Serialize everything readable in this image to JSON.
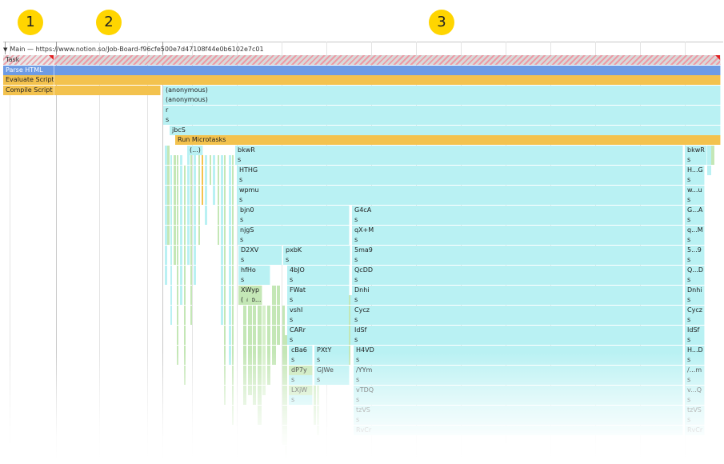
{
  "markers": [
    "1",
    "2",
    "3"
  ],
  "thread_title": "Main — https://www.notion.so/Job-Board-f96cfe500e7d47108f44e0b6102e7c01",
  "colors": {
    "js": "#b9f1f3",
    "js_small": "#c4e7b6",
    "script": "#f3c24e",
    "parse": "#6d9be4",
    "long_task_flag": "#e02020",
    "marker": "#ffd500"
  },
  "left_pane": [
    "Task",
    "Parse HTML",
    "Evaluate Script",
    "Compile Script"
  ],
  "rows": [
    {
      "kind": "task",
      "entries": [
        "Task"
      ]
    },
    {
      "kind": "parse",
      "entries": [
        "Parse HTML"
      ]
    },
    {
      "kind": "script",
      "entries": [
        "Evaluate Script"
      ]
    },
    {
      "kind": "script",
      "entries": [
        "Compile Script",
        "(anonymous)"
      ]
    },
    {
      "kind": "js",
      "entries": [
        "(anonymous)"
      ]
    },
    {
      "kind": "js",
      "entries": [
        "r"
      ]
    },
    {
      "kind": "js",
      "entries": [
        "s"
      ]
    },
    {
      "kind": "js",
      "entries": [
        "jbcS"
      ]
    },
    {
      "kind": "script",
      "entries": [
        "Run Microtasks"
      ]
    },
    {
      "kind": "js",
      "entries": [
        "(...)",
        "bkwR",
        "bkwR"
      ]
    },
    {
      "kind": "js",
      "entries": [
        "s",
        "s"
      ]
    },
    {
      "kind": "js",
      "entries": [
        "HTHG",
        "H...G"
      ]
    },
    {
      "kind": "js",
      "entries": [
        "s",
        "s"
      ]
    },
    {
      "kind": "js",
      "entries": [
        "wpmu",
        "w...u"
      ]
    },
    {
      "kind": "js",
      "entries": [
        "s",
        "s"
      ]
    },
    {
      "kind": "js",
      "entries": [
        "bjn0",
        "G4cA",
        "G...A"
      ]
    },
    {
      "kind": "js",
      "entries": [
        "s",
        "s",
        "s"
      ]
    },
    {
      "kind": "js",
      "entries": [
        "njgS",
        "qX+M",
        "q...M"
      ]
    },
    {
      "kind": "js",
      "entries": [
        "s",
        "s",
        "s"
      ]
    },
    {
      "kind": "js",
      "entries": [
        "D2XV",
        "pxbK",
        "5ma9",
        "5...9"
      ]
    },
    {
      "kind": "js",
      "entries": [
        "s",
        "s",
        "s",
        "s"
      ]
    },
    {
      "kind": "js",
      "entries": [
        "hfHo",
        "4bJO",
        "QcDD",
        "Q...D"
      ]
    },
    {
      "kind": "js",
      "entries": [
        "s",
        "s",
        "s",
        "s"
      ]
    },
    {
      "kind": "js",
      "entries": [
        "XWyp",
        "FWat",
        "Dnhi",
        "Dnhi"
      ]
    },
    {
      "kind": "js",
      "entries": [
        "(ano...us)",
        "s",
        "s",
        "s"
      ]
    },
    {
      "kind": "js",
      "entries": [
        "vshI",
        "Cycz",
        "Cycz"
      ]
    },
    {
      "kind": "js",
      "entries": [
        "s",
        "s",
        "s"
      ]
    },
    {
      "kind": "js",
      "entries": [
        "CARr",
        "IdSf",
        "IdSf"
      ]
    },
    {
      "kind": "js",
      "entries": [
        "s",
        "s",
        "s"
      ]
    },
    {
      "kind": "js",
      "entries": [
        "cBa6",
        "PXtY",
        "H4VD",
        "H...D"
      ]
    },
    {
      "kind": "js",
      "entries": [
        "s",
        "s",
        "s",
        "s"
      ]
    },
    {
      "kind": "js",
      "entries": [
        "dP7y",
        "GJWe",
        "/YYm",
        "/...m"
      ]
    },
    {
      "kind": "js",
      "entries": [
        "s",
        "s",
        "s",
        "s"
      ]
    },
    {
      "kind": "js",
      "entries": [
        "LXjW",
        "vTDQ",
        "v...Q"
      ]
    },
    {
      "kind": "js",
      "entries": [
        "s",
        "s",
        "s"
      ]
    },
    {
      "kind": "js",
      "entries": [
        "tzVS",
        "tzVS"
      ]
    },
    {
      "kind": "js",
      "entries": [
        "s",
        "s"
      ]
    },
    {
      "kind": "js",
      "entries": [
        "RvCr",
        "RvCr"
      ]
    }
  ]
}
